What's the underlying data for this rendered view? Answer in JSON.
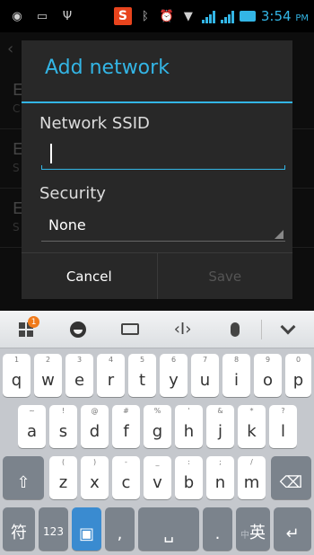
{
  "statusbar": {
    "icons": [
      "target-icon",
      "sd-card-icon",
      "usb-icon",
      "app-s-icon",
      "bluetooth-icon",
      "alarm-icon",
      "wifi-icon",
      "signal-icon",
      "signal-icon",
      "battery-icon"
    ],
    "app_s_label": "S",
    "time": "3:54",
    "ampm": "PM",
    "accent_color": "#33b5e5"
  },
  "dialog": {
    "title": "Add network",
    "ssid_label": "Network SSID",
    "ssid_value": "",
    "security_label": "Security",
    "security_value": "None",
    "cancel_label": "Cancel",
    "save_label": "Save"
  },
  "background_list": {
    "rows": [
      {
        "title": "E",
        "sub": "C"
      },
      {
        "title": "E",
        "sub": "S"
      },
      {
        "title": "E",
        "sub": "S"
      }
    ]
  },
  "keyboard": {
    "toolbar": [
      "apps-icon",
      "emoji-icon",
      "keyboard-icon",
      "cursor-move-icon",
      "mic-icon",
      "collapse-icon"
    ],
    "toolbar_badge": "1",
    "row1": [
      {
        "main": "q",
        "sup": "1"
      },
      {
        "main": "w",
        "sup": "2"
      },
      {
        "main": "e",
        "sup": "3"
      },
      {
        "main": "r",
        "sup": "4"
      },
      {
        "main": "t",
        "sup": "5"
      },
      {
        "main": "y",
        "sup": "6"
      },
      {
        "main": "u",
        "sup": "7"
      },
      {
        "main": "i",
        "sup": "8"
      },
      {
        "main": "o",
        "sup": "9"
      },
      {
        "main": "p",
        "sup": "0"
      }
    ],
    "row2": [
      {
        "main": "a",
        "sup": "~"
      },
      {
        "main": "s",
        "sup": "!"
      },
      {
        "main": "d",
        "sup": "@"
      },
      {
        "main": "f",
        "sup": "#"
      },
      {
        "main": "g",
        "sup": "%"
      },
      {
        "main": "h",
        "sup": "'"
      },
      {
        "main": "j",
        "sup": "&"
      },
      {
        "main": "k",
        "sup": "*"
      },
      {
        "main": "l",
        "sup": "?"
      }
    ],
    "row3": [
      {
        "main": "z",
        "sup": "("
      },
      {
        "main": "x",
        "sup": ")"
      },
      {
        "main": "c",
        "sup": "-"
      },
      {
        "main": "v",
        "sup": "_"
      },
      {
        "main": "b",
        "sup": ":"
      },
      {
        "main": "n",
        "sup": ";"
      },
      {
        "main": "m",
        "sup": "/"
      }
    ],
    "shift_label": "⇧",
    "delete_label": "⌫",
    "symbol_label": "符",
    "num_label": "123",
    "lang_label": "英",
    "lang_sub": "中",
    "comma": ",",
    "period": ".",
    "enter_label": "↵"
  }
}
